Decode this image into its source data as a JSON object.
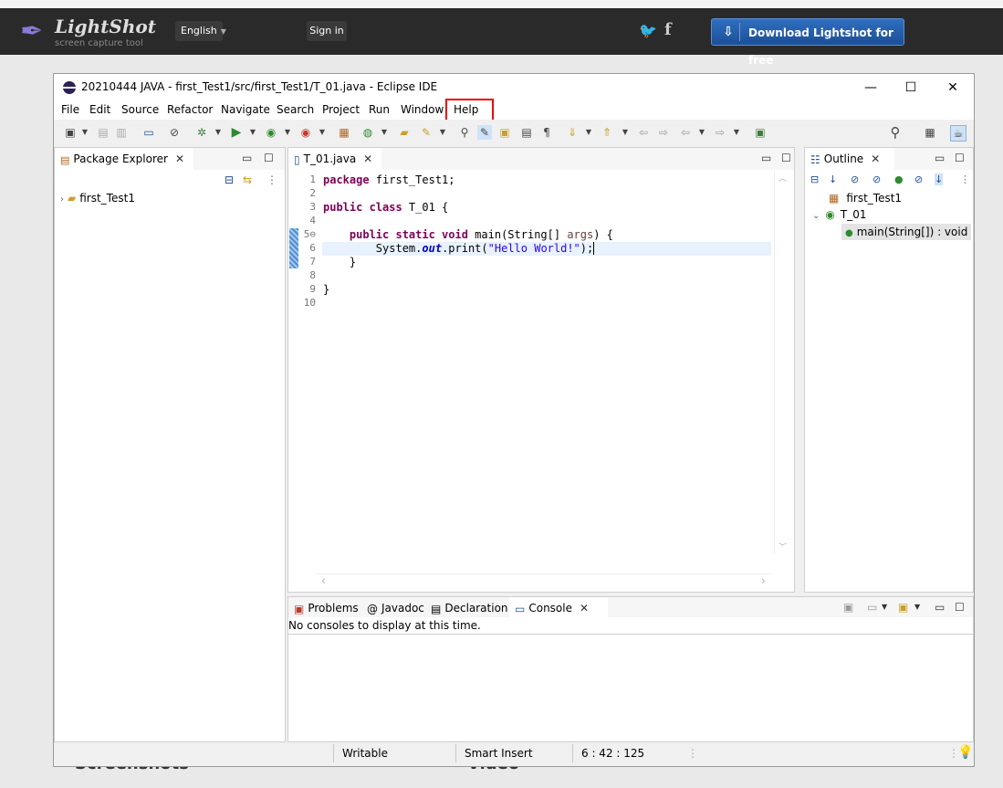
{
  "lightshot": {
    "brand": "LightShot",
    "tagline": "screen capture tool",
    "language": "English",
    "signin": "Sign in",
    "download": "Download Lightshot for free",
    "bg_left": "Screenshots",
    "bg_right": "Video"
  },
  "window": {
    "title": "20210444 JAVA - first_Test1/src/first_Test1/T_01.java - Eclipse IDE"
  },
  "menu": [
    "File",
    "Edit",
    "Source",
    "Refactor",
    "Navigate",
    "Search",
    "Project",
    "Run",
    "Window",
    "Help"
  ],
  "package_explorer": {
    "tab": "Package Explorer",
    "project": "first_Test1"
  },
  "editor": {
    "tab": "T_01.java",
    "line_numbers": [
      "1",
      "2",
      "3",
      "4",
      "5⊖",
      "6",
      "7",
      "8",
      "9",
      "10"
    ]
  },
  "outline": {
    "tab": "Outline",
    "items": [
      "first_Test1",
      "T_01",
      "main(String[]) : void"
    ]
  },
  "console": {
    "tabs": [
      "Problems",
      "Javadoc",
      "Declaration",
      "Console"
    ],
    "message": "No consoles to display at this time."
  },
  "status": {
    "writable": "Writable",
    "insert_mode": "Smart Insert",
    "position": "6 : 42 : 125"
  },
  "colors": {
    "keyword": "#7f0055",
    "string": "#2a00ff",
    "field": "#0000c0",
    "highlight": "#e00000",
    "download_button": "#2f6fc0"
  }
}
